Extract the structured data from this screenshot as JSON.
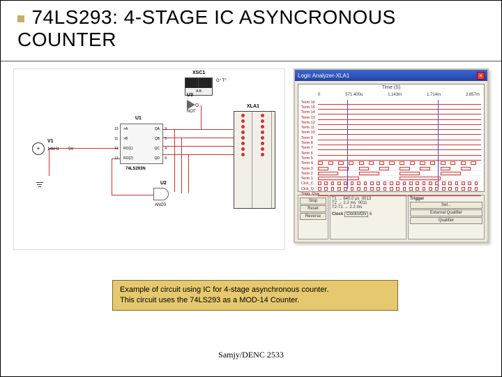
{
  "title": "74LS293: 4-STAGE IC ASYNCRONOUS COUNTER",
  "schematic": {
    "xsc1": "XSC1",
    "xla1": "XLA1",
    "u1": {
      "ref": "U1",
      "part": "74LS293N",
      "pins_left": [
        "10",
        "11",
        "12",
        "13"
      ],
      "pins_inL": [
        ">A",
        ">B",
        "RO(1)",
        "RO(2)"
      ],
      "pins_inR": [
        "QA",
        "QB",
        "QC",
        "QD"
      ],
      "pins_right": [
        "9",
        "5",
        "4",
        "8"
      ]
    },
    "u2": {
      "ref": "U2",
      "part": "AND3"
    },
    "u3": {
      "ref": "U3",
      "part": "NOT"
    },
    "source": {
      "ref": "V1",
      "freq": "14kHz",
      "ampl": "5V"
    },
    "scope_ports": "A   B",
    "scope_io": "G°  T°"
  },
  "analyzer": {
    "title": "Logic Analyzer-XLA1",
    "time_axis_label": "Time (S)",
    "xticks": [
      "0",
      "571.400u",
      "1.143m",
      "1.714m",
      "2.857m"
    ],
    "rows": [
      "Term 16",
      "Term 15",
      "Term 14",
      "Term 13",
      "Term 12",
      "Term 11",
      "Term 10",
      "Term 9",
      "Term 8",
      "Term 7",
      "Term 6",
      "Term 5",
      "Term 4",
      "Term 3",
      "Term 2",
      "Term 1",
      "Clck_C",
      "Clck_Q",
      "Trigg_Qua"
    ],
    "controls": {
      "buttons": [
        "Stop",
        "Reset",
        "Reverse"
      ],
      "readout_labels": [
        "T1 →",
        "T2 →",
        "T2-T1 →"
      ],
      "readout_t": [
        "640.0 µs",
        "2.2 ms"
      ],
      "readout_v": [
        "0013",
        "0011"
      ],
      "readout_dur": "2.2 ms",
      "groupA_title": "Clock",
      "groupA_items": [
        "Clocks/Div",
        "6"
      ],
      "groupB_title": "Trigger",
      "groupB_items": [
        "Set...",
        "External Qualifier",
        "Qualifier"
      ]
    }
  },
  "caption": {
    "l1": "Example of circuit using IC for 4-stage asynchronous counter.",
    "l2": "This circuit uses the 74LS293 as a MOD-14 Counter."
  },
  "footer": "Samjy/DENC 2533"
}
